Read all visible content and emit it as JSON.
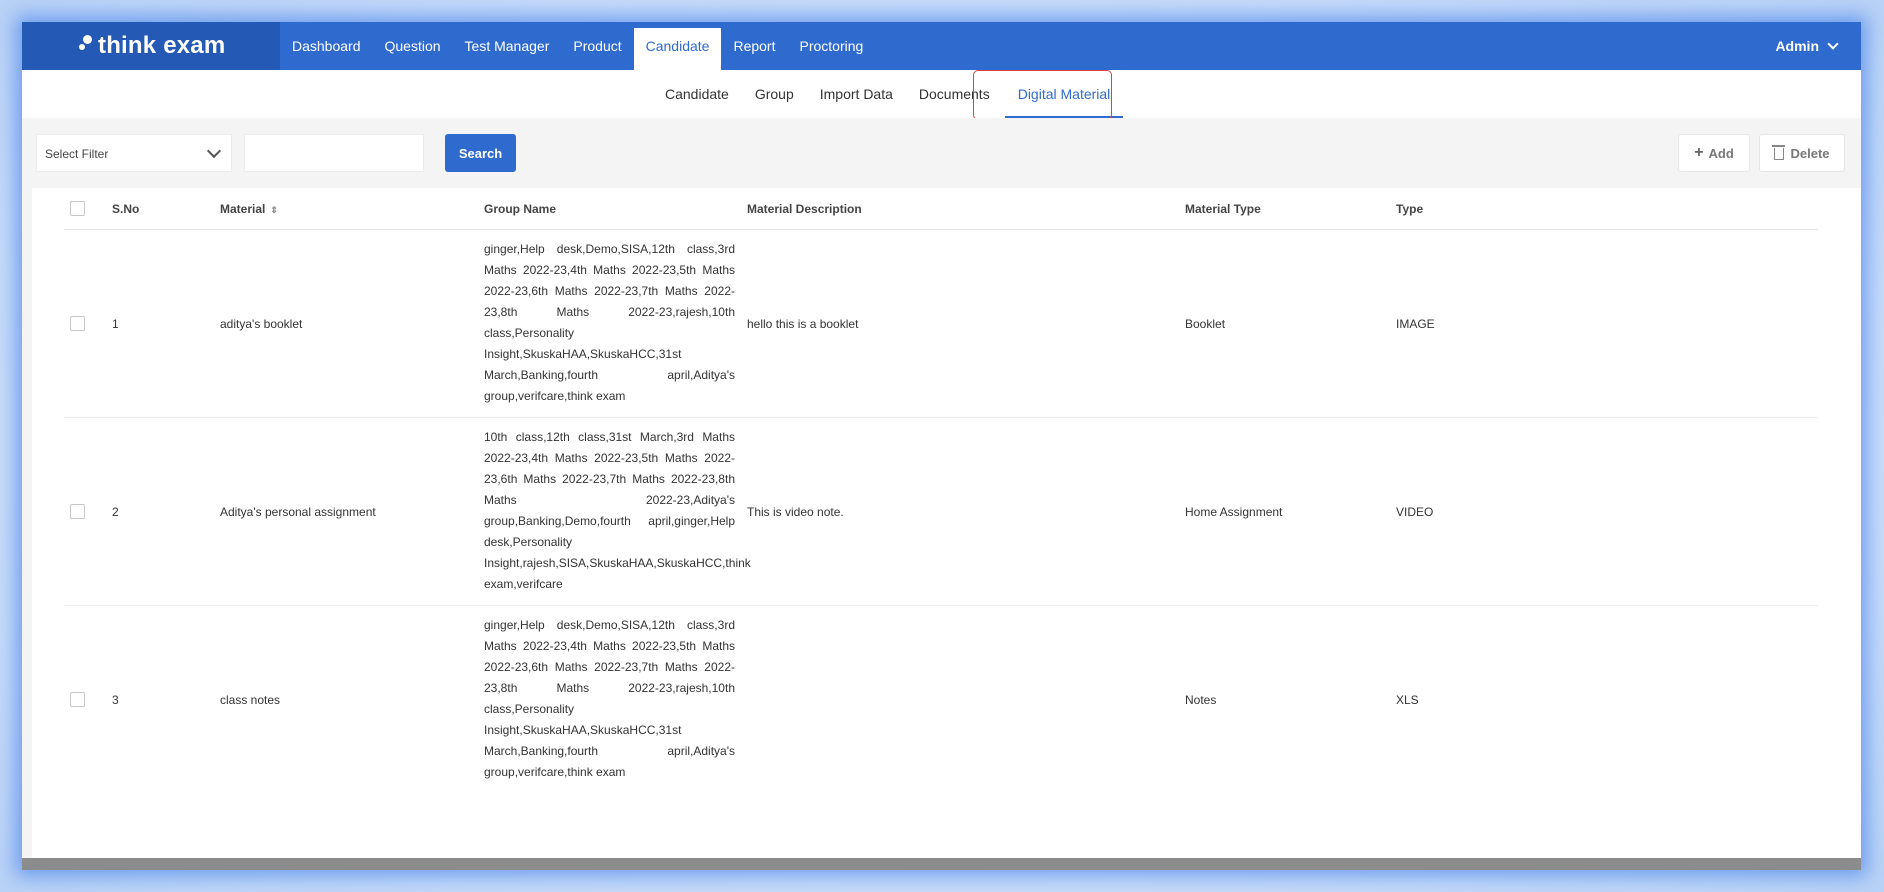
{
  "app": {
    "logo": "think exam",
    "user": "Admin"
  },
  "nav": [
    "Dashboard",
    "Question",
    "Test Manager",
    "Product",
    "Candidate",
    "Report",
    "Proctoring"
  ],
  "nav_active": "Candidate",
  "subnav": [
    "Candidate",
    "Group",
    "Import Data",
    "Documents",
    "Digital Material"
  ],
  "subnav_active": "Digital Material",
  "filter": {
    "select_label": "Select Filter",
    "search_value": "",
    "search_button": "Search"
  },
  "actions": {
    "add": "Add",
    "delete": "Delete"
  },
  "table": {
    "headers": {
      "sno": "S.No",
      "material": "Material",
      "group": "Group Name",
      "description": "Material Description",
      "material_type": "Material Type",
      "type": "Type"
    },
    "rows": [
      {
        "sno": "1",
        "material": "aditya's booklet",
        "group": "ginger,Help desk,Demo,SISA,12th class,3rd Maths 2022-23,4th Maths 2022-23,5th Maths 2022-23,6th Maths 2022-23,7th Maths 2022-23,8th Maths 2022-23,rajesh,10th class,Personality Insight,SkuskaHAA,SkuskaHCC,31st March,Banking,fourth april,Aditya's group,verifcare,think exam",
        "description": "hello this is a booklet",
        "material_type": "Booklet",
        "type": "IMAGE"
      },
      {
        "sno": "2",
        "material": "Aditya's personal assignment",
        "group": "10th class,12th class,31st March,3rd Maths 2022-23,4th Maths 2022-23,5th Maths 2022-23,6th Maths 2022-23,7th Maths 2022-23,8th Maths 2022-23,Aditya's group,Banking,Demo,fourth april,ginger,Help desk,Personality Insight,rajesh,SISA,SkuskaHAA,SkuskaHCC,think exam,verifcare",
        "description": "This is video note.",
        "material_type": "Home Assignment",
        "type": "VIDEO"
      },
      {
        "sno": "3",
        "material": "class notes",
        "group": "ginger,Help desk,Demo,SISA,12th class,3rd Maths 2022-23,4th Maths 2022-23,5th Maths 2022-23,6th Maths 2022-23,7th Maths 2022-23,8th Maths 2022-23,rajesh,10th class,Personality Insight,SkuskaHAA,SkuskaHCC,31st March,Banking,fourth april,Aditya's group,verifcare,think exam",
        "description": "",
        "material_type": "Notes",
        "type": "XLS"
      }
    ]
  },
  "colors": {
    "brand": "#2f6bcf",
    "brand_dark": "#2459b5",
    "highlight": "#e04040"
  }
}
